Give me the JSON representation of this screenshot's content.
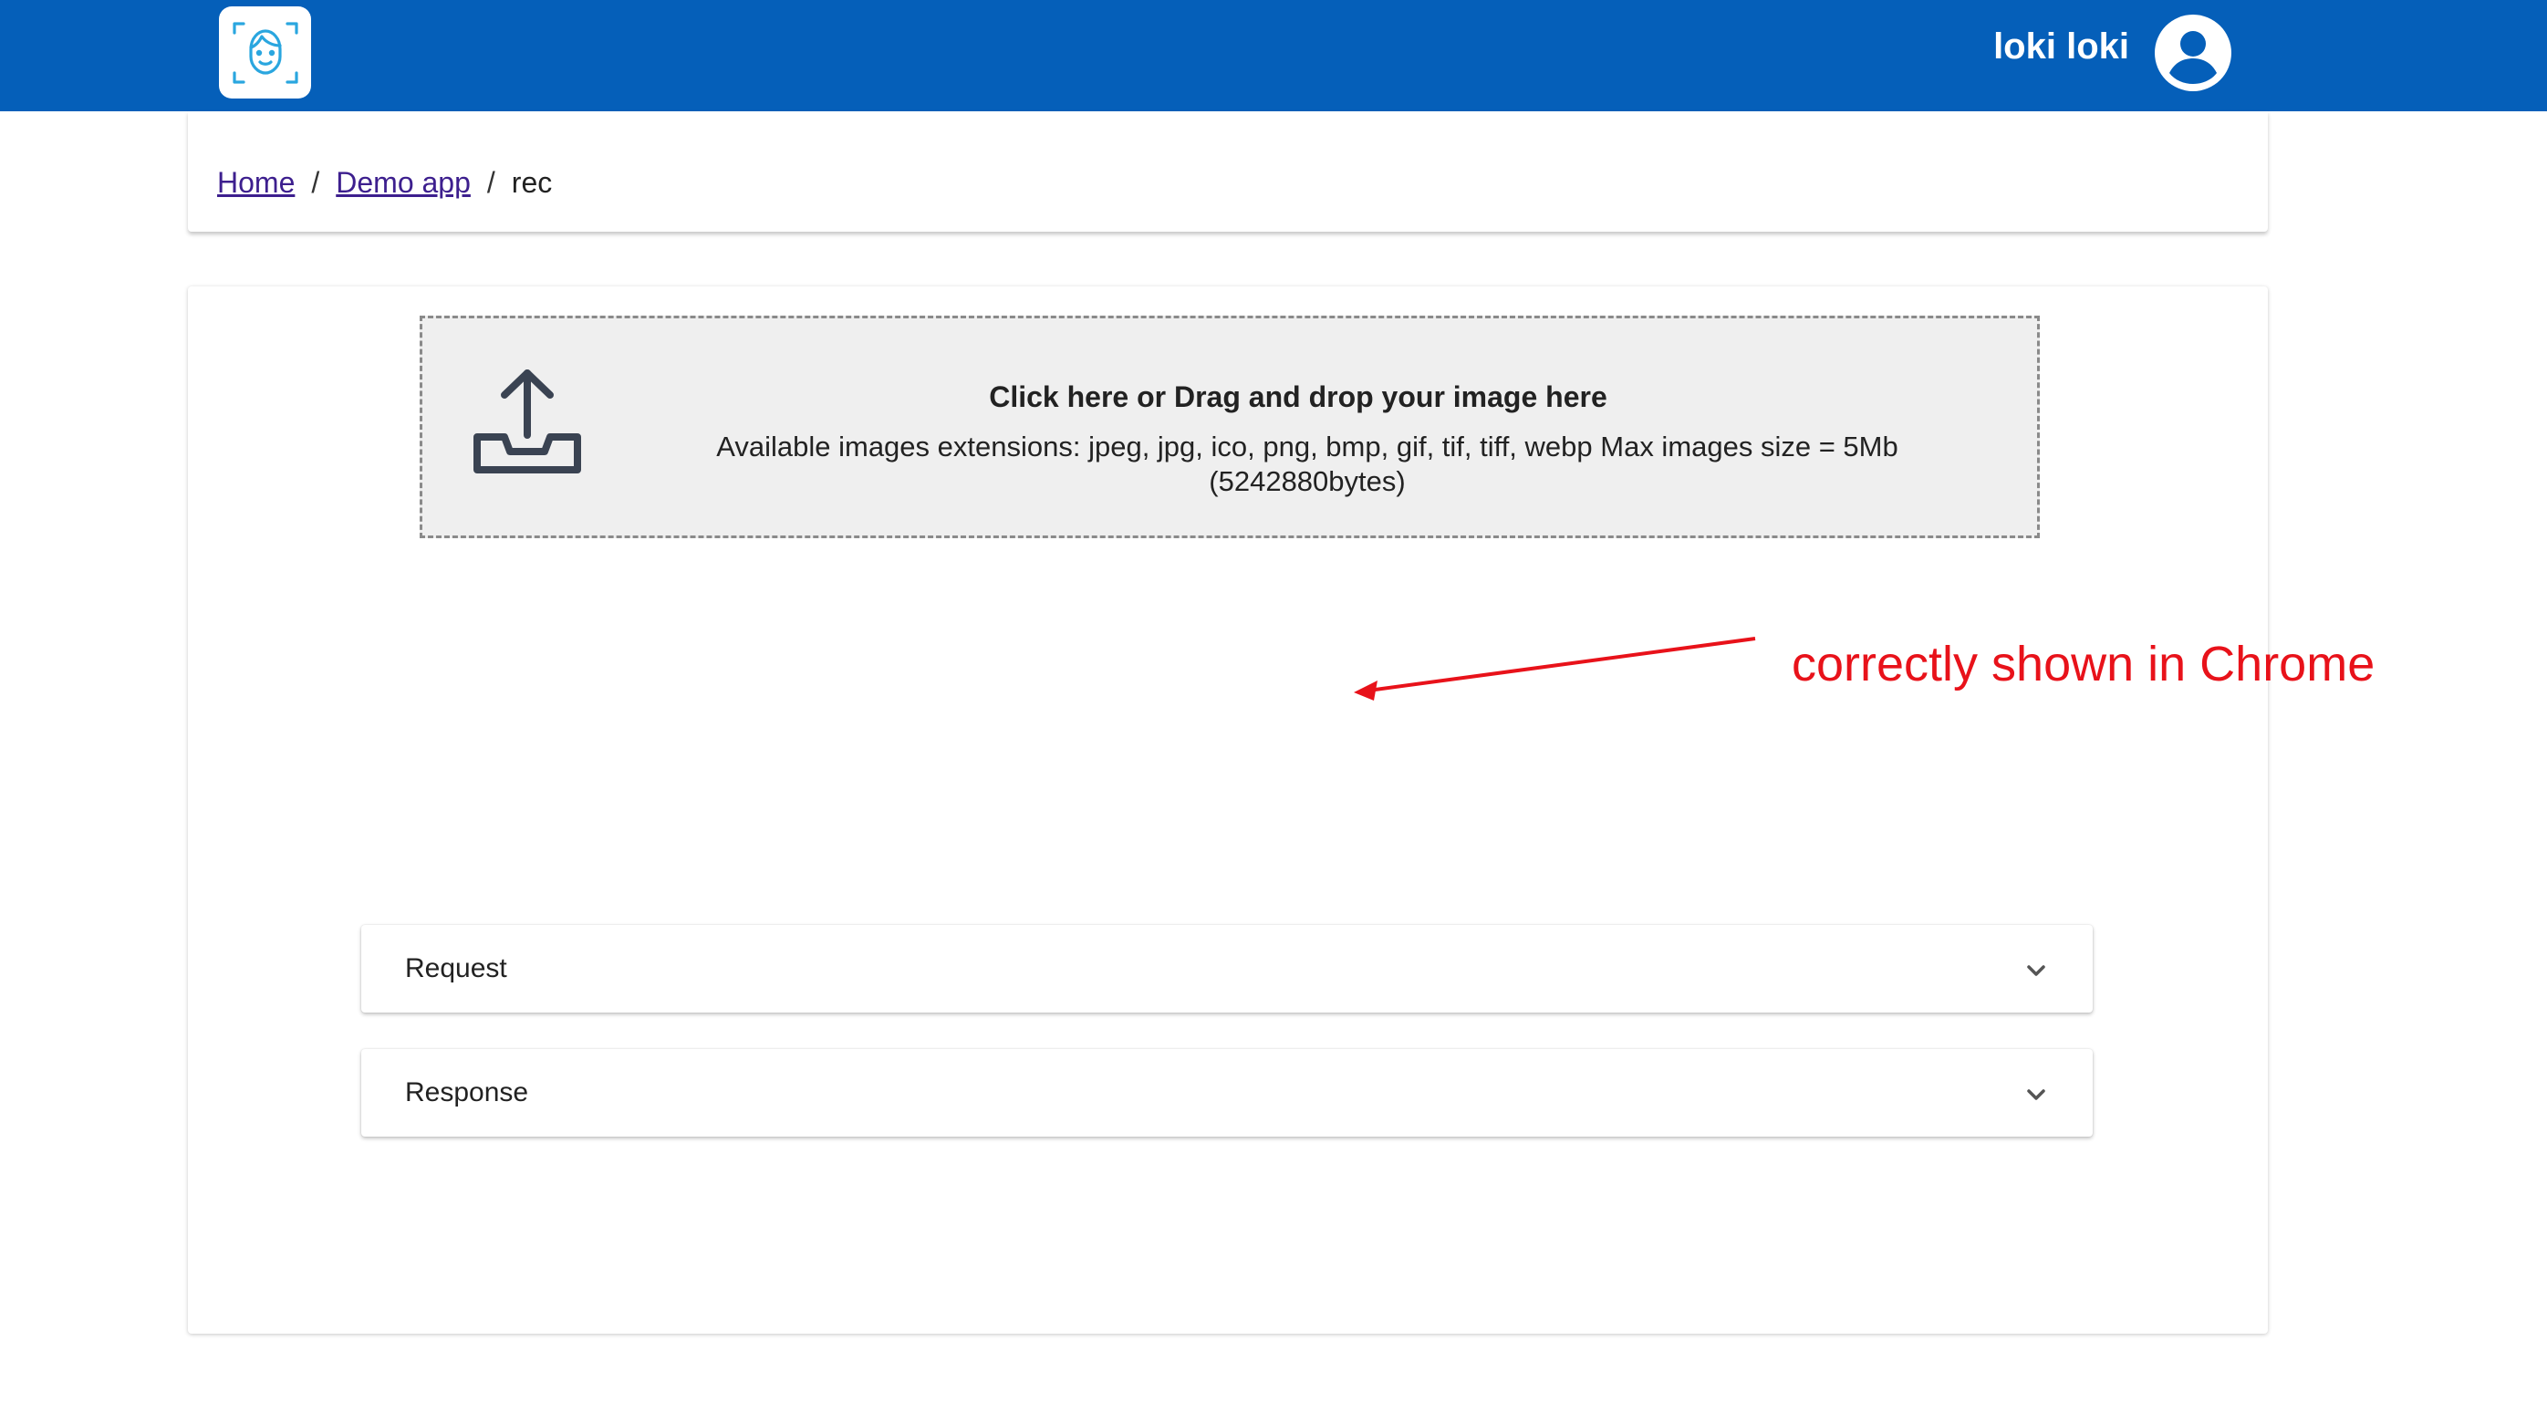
{
  "header": {
    "user_name": "loki loki",
    "brand_color": "#055fb9",
    "logo_icon": "face-scan-icon",
    "avatar_icon": "account-circle-icon"
  },
  "breadcrumb": {
    "items": [
      {
        "label": "Home",
        "link": true
      },
      {
        "label": "Demo app",
        "link": true
      },
      {
        "label": "rec",
        "link": false
      }
    ],
    "separator": "/"
  },
  "dropzone": {
    "title": "Click here or Drag and drop your image here",
    "description": "Available images extensions: jpeg, jpg, ico, png, bmp, gif, tif, tiff, webp Max images size = 5Mb (5242880bytes)",
    "icon": "upload-tray-icon"
  },
  "annotation": {
    "text": "correctly shown in Chrome",
    "color": "#e8121a"
  },
  "accordions": [
    {
      "label": "Request",
      "icon": "chevron-down-icon"
    },
    {
      "label": "Response",
      "icon": "chevron-down-icon"
    }
  ]
}
